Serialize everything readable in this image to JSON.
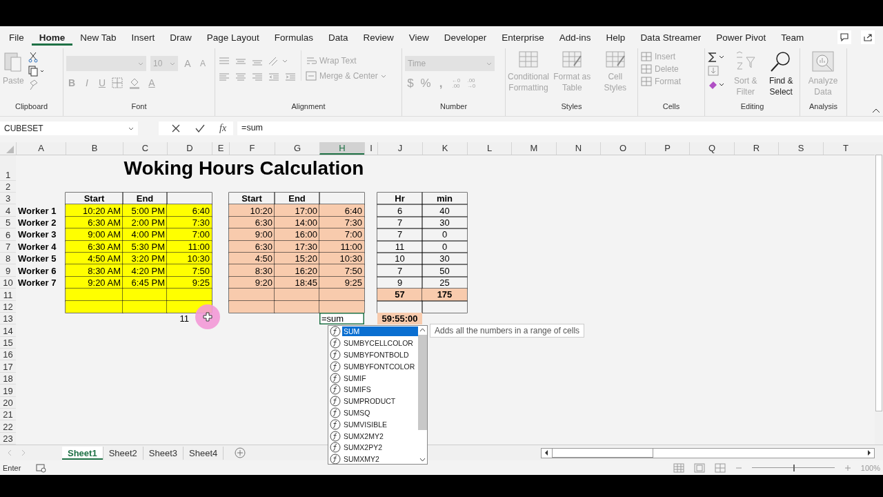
{
  "ribbon_tabs": [
    {
      "label": "File",
      "selected": false
    },
    {
      "label": "Home",
      "selected": true
    },
    {
      "label": "New Tab",
      "selected": false
    },
    {
      "label": "Insert",
      "selected": false
    },
    {
      "label": "Draw",
      "selected": false
    },
    {
      "label": "Page Layout",
      "selected": false
    },
    {
      "label": "Formulas",
      "selected": false
    },
    {
      "label": "Data",
      "selected": false
    },
    {
      "label": "Review",
      "selected": false
    },
    {
      "label": "View",
      "selected": false
    },
    {
      "label": "Developer",
      "selected": false
    },
    {
      "label": "Enterprise",
      "selected": false
    },
    {
      "label": "Add-ins",
      "selected": false
    },
    {
      "label": "Help",
      "selected": false
    },
    {
      "label": "Data Streamer",
      "selected": false
    },
    {
      "label": "Power Pivot",
      "selected": false
    },
    {
      "label": "Team",
      "selected": false
    }
  ],
  "ribbon": {
    "clipboard": {
      "label": "Clipboard",
      "paste": {
        "label": "Paste",
        "disabled": true
      }
    },
    "font": {
      "label": "Font",
      "size": "10",
      "disabled": true,
      "grow": "A",
      "shrink": "A",
      "style_buttons": [
        {
          "label": "B"
        },
        {
          "label": "I"
        },
        {
          "label": "U"
        }
      ],
      "font_color": "A"
    },
    "alignment": {
      "label": "Alignment",
      "wrap_text": "Wrap Text",
      "merge_center": "Merge & Center",
      "disabled": true
    },
    "number": {
      "label": "Number",
      "format": "Time",
      "disabled": true,
      "currency": "$",
      "percent": "%",
      "comma": ",",
      "increase_decimal": [
        "←0",
        ".00"
      ],
      "decrease_decimal": [
        ".00",
        "→0"
      ]
    },
    "styles": {
      "label": "Styles",
      "buttons": [
        {
          "label": "Conditional Formatting",
          "disabled": true
        },
        {
          "label": "Format as Table",
          "disabled": true
        },
        {
          "label": "Cell Styles",
          "disabled": true
        }
      ]
    },
    "cells": {
      "label": "Cells",
      "buttons": [
        {
          "label": "Insert",
          "disabled": true
        },
        {
          "label": "Delete",
          "disabled": true
        },
        {
          "label": "Format",
          "disabled": true
        }
      ]
    },
    "editing": {
      "label": "Editing",
      "buttons": [
        {
          "label": "Sort & Filter",
          "disabled": true
        },
        {
          "label": "Find & Select",
          "disabled": false
        }
      ]
    },
    "analysis": {
      "label": "Analysis",
      "buttons": [
        {
          "label": "Analyze Data",
          "disabled": true
        }
      ]
    }
  },
  "formula_bar": {
    "name_box": "CUBESET",
    "insert_function": "fx",
    "formula": "=sum"
  },
  "columns": [
    {
      "label": "A",
      "selected": false
    },
    {
      "label": "B",
      "selected": false
    },
    {
      "label": "C",
      "selected": false
    },
    {
      "label": "D",
      "selected": false
    },
    {
      "label": "E",
      "selected": false
    },
    {
      "label": "F",
      "selected": false
    },
    {
      "label": "G",
      "selected": false
    },
    {
      "label": "H",
      "selected": true
    },
    {
      "label": "I",
      "selected": false
    },
    {
      "label": "J",
      "selected": false
    },
    {
      "label": "K",
      "selected": false
    },
    {
      "label": "L",
      "selected": false
    },
    {
      "label": "M",
      "selected": false
    },
    {
      "label": "N",
      "selected": false
    },
    {
      "label": "O",
      "selected": false
    },
    {
      "label": "P",
      "selected": false
    },
    {
      "label": "Q",
      "selected": false
    },
    {
      "label": "R",
      "selected": false
    },
    {
      "label": "S",
      "selected": false
    },
    {
      "label": "T",
      "selected": false
    }
  ],
  "rows": [
    {
      "label": "1",
      "cells": [
        {},
        {
          "kind": "title",
          "text": "Woking Hours Calculation"
        }
      ]
    },
    {
      "label": "2",
      "cells": []
    },
    {
      "label": "3",
      "cells": [
        {},
        {
          "kind": "header",
          "text": "Start",
          "boxed": true
        },
        {
          "kind": "header",
          "text": "End",
          "boxed": true
        },
        {
          "kind": "blank",
          "boxed": true
        },
        {},
        {
          "kind": "header",
          "text": "Start",
          "boxed": true
        },
        {
          "kind": "header",
          "text": "End",
          "boxed": true
        },
        {
          "kind": "blank",
          "boxed": true
        },
        {},
        {
          "kind": "header",
          "text": "Hr",
          "boxed": true
        },
        {
          "kind": "header",
          "text": "min",
          "boxed": true
        }
      ]
    },
    {
      "label": "4",
      "cells": [
        {
          "kind": "name",
          "text": "Worker 1"
        },
        {
          "kind": "time",
          "text": "10:20 AM",
          "boxed": true,
          "color": "#ffff00"
        },
        {
          "kind": "time",
          "text": "5:00 PM",
          "boxed": true,
          "color": "#ffff00"
        },
        {
          "kind": "time",
          "text": "6:40",
          "boxed": true,
          "color": "#ffff00"
        },
        {},
        {
          "kind": "time",
          "text": "10:20",
          "boxed": true,
          "color": "#f8cbad"
        },
        {
          "kind": "time",
          "text": "17:00",
          "boxed": true,
          "color": "#f8cbad"
        },
        {
          "kind": "time",
          "text": "6:40",
          "boxed": true,
          "color": "#f8cbad"
        },
        {},
        {
          "kind": "count",
          "text": "6",
          "boxed": true
        },
        {
          "kind": "count",
          "text": "40",
          "boxed": true
        }
      ]
    },
    {
      "label": "5",
      "cells": [
        {
          "kind": "name",
          "text": "Worker 2"
        },
        {
          "kind": "time",
          "text": "6:30 AM",
          "boxed": true,
          "color": "#ffff00"
        },
        {
          "kind": "time",
          "text": "2:00 PM",
          "boxed": true,
          "color": "#ffff00"
        },
        {
          "kind": "time",
          "text": "7:30",
          "boxed": true,
          "color": "#ffff00"
        },
        {},
        {
          "kind": "time",
          "text": "6:30",
          "boxed": true,
          "color": "#f8cbad"
        },
        {
          "kind": "time",
          "text": "14:00",
          "boxed": true,
          "color": "#f8cbad"
        },
        {
          "kind": "time",
          "text": "7:30",
          "boxed": true,
          "color": "#f8cbad"
        },
        {},
        {
          "kind": "count",
          "text": "7",
          "boxed": true
        },
        {
          "kind": "count",
          "text": "30",
          "boxed": true
        }
      ]
    },
    {
      "label": "6",
      "cells": [
        {
          "kind": "name",
          "text": "Worker 3"
        },
        {
          "kind": "time",
          "text": "9:00 AM",
          "boxed": true,
          "color": "#ffff00"
        },
        {
          "kind": "time",
          "text": "4:00 PM",
          "boxed": true,
          "color": "#ffff00"
        },
        {
          "kind": "time",
          "text": "7:00",
          "boxed": true,
          "color": "#ffff00"
        },
        {},
        {
          "kind": "time",
          "text": "9:00",
          "boxed": true,
          "color": "#f8cbad"
        },
        {
          "kind": "time",
          "text": "16:00",
          "boxed": true,
          "color": "#f8cbad"
        },
        {
          "kind": "time",
          "text": "7:00",
          "boxed": true,
          "color": "#f8cbad"
        },
        {},
        {
          "kind": "count",
          "text": "7",
          "boxed": true
        },
        {
          "kind": "count",
          "text": "0",
          "boxed": true
        }
      ]
    },
    {
      "label": "7",
      "cells": [
        {
          "kind": "name",
          "text": "Worker 4"
        },
        {
          "kind": "time",
          "text": "6:30 AM",
          "boxed": true,
          "color": "#ffff00"
        },
        {
          "kind": "time",
          "text": "5:30 PM",
          "boxed": true,
          "color": "#ffff00"
        },
        {
          "kind": "time",
          "text": "11:00",
          "boxed": true,
          "color": "#ffff00"
        },
        {},
        {
          "kind": "time",
          "text": "6:30",
          "boxed": true,
          "color": "#f8cbad"
        },
        {
          "kind": "time",
          "text": "17:30",
          "boxed": true,
          "color": "#f8cbad"
        },
        {
          "kind": "time",
          "text": "11:00",
          "boxed": true,
          "color": "#f8cbad"
        },
        {},
        {
          "kind": "count",
          "text": "11",
          "boxed": true
        },
        {
          "kind": "count",
          "text": "0",
          "boxed": true
        }
      ]
    },
    {
      "label": "8",
      "cells": [
        {
          "kind": "name",
          "text": "Worker 5"
        },
        {
          "kind": "time",
          "text": "4:50 AM",
          "boxed": true,
          "color": "#ffff00"
        },
        {
          "kind": "time",
          "text": "3:20 PM",
          "boxed": true,
          "color": "#ffff00"
        },
        {
          "kind": "time",
          "text": "10:30",
          "boxed": true,
          "color": "#ffff00"
        },
        {},
        {
          "kind": "time",
          "text": "4:50",
          "boxed": true,
          "color": "#f8cbad"
        },
        {
          "kind": "time",
          "text": "15:20",
          "boxed": true,
          "color": "#f8cbad"
        },
        {
          "kind": "time",
          "text": "10:30",
          "boxed": true,
          "color": "#f8cbad"
        },
        {},
        {
          "kind": "count",
          "text": "10",
          "boxed": true
        },
        {
          "kind": "count",
          "text": "30",
          "boxed": true
        }
      ]
    },
    {
      "label": "9",
      "cells": [
        {
          "kind": "name",
          "text": "Worker 6"
        },
        {
          "kind": "time",
          "text": "8:30 AM",
          "boxed": true,
          "color": "#ffff00"
        },
        {
          "kind": "time",
          "text": "4:20 PM",
          "boxed": true,
          "color": "#ffff00"
        },
        {
          "kind": "time",
          "text": "7:50",
          "boxed": true,
          "color": "#ffff00"
        },
        {},
        {
          "kind": "time",
          "text": "8:30",
          "boxed": true,
          "color": "#f8cbad"
        },
        {
          "kind": "time",
          "text": "16:20",
          "boxed": true,
          "color": "#f8cbad"
        },
        {
          "kind": "time",
          "text": "7:50",
          "boxed": true,
          "color": "#f8cbad"
        },
        {},
        {
          "kind": "count",
          "text": "7",
          "boxed": true
        },
        {
          "kind": "count",
          "text": "50",
          "boxed": true
        }
      ]
    },
    {
      "label": "10",
      "cells": [
        {
          "kind": "name",
          "text": "Worker 7"
        },
        {
          "kind": "time",
          "text": "9:20 AM",
          "boxed": true,
          "color": "#ffff00"
        },
        {
          "kind": "time",
          "text": "6:45 PM",
          "boxed": true,
          "color": "#ffff00"
        },
        {
          "kind": "time",
          "text": "9:25",
          "boxed": true,
          "color": "#ffff00"
        },
        {},
        {
          "kind": "time",
          "text": "9:20",
          "boxed": true,
          "color": "#f8cbad"
        },
        {
          "kind": "time",
          "text": "18:45",
          "boxed": true,
          "color": "#f8cbad"
        },
        {
          "kind": "time",
          "text": "9:25",
          "boxed": true,
          "color": "#f8cbad"
        },
        {},
        {
          "kind": "count",
          "text": "9",
          "boxed": true
        },
        {
          "kind": "count",
          "text": "25",
          "boxed": true
        }
      ]
    },
    {
      "label": "11",
      "cells": [
        {},
        {
          "kind": "blank",
          "boxed": true,
          "color": "#ffff00"
        },
        {
          "kind": "blank",
          "boxed": true,
          "color": "#ffff00"
        },
        {
          "kind": "blank",
          "boxed": true,
          "color": "#ffff00"
        },
        {},
        {
          "kind": "blank",
          "boxed": true,
          "color": "#f8cbad"
        },
        {
          "kind": "blank",
          "boxed": true,
          "color": "#f8cbad"
        },
        {
          "kind": "blank",
          "boxed": true,
          "color": "#f8cbad"
        },
        {},
        {
          "kind": "total",
          "text": "57",
          "boxed": true,
          "color": "#f8cbad"
        },
        {
          "kind": "total",
          "text": "175",
          "boxed": true,
          "color": "#f8cbad"
        }
      ]
    },
    {
      "label": "12",
      "cells": [
        {},
        {
          "kind": "blank",
          "boxed": true,
          "color": "#ffff00"
        },
        {
          "kind": "blank",
          "boxed": true,
          "color": "#ffff00"
        },
        {
          "kind": "blank",
          "boxed": true,
          "color": "#ffff00"
        },
        {},
        {
          "kind": "blank",
          "boxed": true,
          "color": "#f8cbad"
        },
        {
          "kind": "blank",
          "boxed": true,
          "color": "#f8cbad"
        },
        {
          "kind": "blank",
          "boxed": true,
          "color": "#f8cbad"
        },
        {},
        {
          "kind": "blank",
          "boxed": true
        },
        {
          "kind": "blank",
          "boxed": true
        }
      ]
    },
    {
      "label": "13",
      "cells": [
        {},
        {},
        {},
        {
          "kind": "number",
          "text": "11"
        },
        {},
        {},
        {},
        {
          "kind": "editing",
          "text": "=sum"
        },
        {},
        {
          "kind": "total",
          "text": "59:55:00",
          "color": "#f8cbad"
        }
      ]
    },
    {
      "label": "14",
      "cells": []
    },
    {
      "label": "15",
      "cells": []
    },
    {
      "label": "16",
      "cells": []
    },
    {
      "label": "17",
      "cells": []
    },
    {
      "label": "18",
      "cells": []
    },
    {
      "label": "19",
      "cells": []
    },
    {
      "label": "20",
      "cells": []
    },
    {
      "label": "21",
      "cells": []
    },
    {
      "label": "22",
      "cells": []
    },
    {
      "label": "23",
      "cells": []
    }
  ],
  "autocomplete": {
    "items": [
      {
        "label": "SUM",
        "selected": true
      },
      {
        "label": "SUMBYCELLCOLOR",
        "selected": false
      },
      {
        "label": "SUMBYFONTBOLD",
        "selected": false
      },
      {
        "label": "SUMBYFONTCOLOR",
        "selected": false
      },
      {
        "label": "SUMIF",
        "selected": false
      },
      {
        "label": "SUMIFS",
        "selected": false
      },
      {
        "label": "SUMPRODUCT",
        "selected": false
      },
      {
        "label": "SUMSQ",
        "selected": false
      },
      {
        "label": "SUMVISIBLE",
        "selected": false
      },
      {
        "label": "SUMX2MY2",
        "selected": false
      },
      {
        "label": "SUMX2PY2",
        "selected": false
      },
      {
        "label": "SUMXMY2",
        "selected": false
      }
    ],
    "tooltip": "Adds all the numbers in a range of cells"
  },
  "sheet_tabs": [
    {
      "label": "Sheet1",
      "selected": true
    },
    {
      "label": "Sheet2",
      "selected": false
    },
    {
      "label": "Sheet3",
      "selected": false
    },
    {
      "label": "Sheet4",
      "selected": false
    }
  ],
  "status_bar": {
    "mode": "Enter",
    "zoom": {
      "label": "100%",
      "level": 0.5
    }
  }
}
